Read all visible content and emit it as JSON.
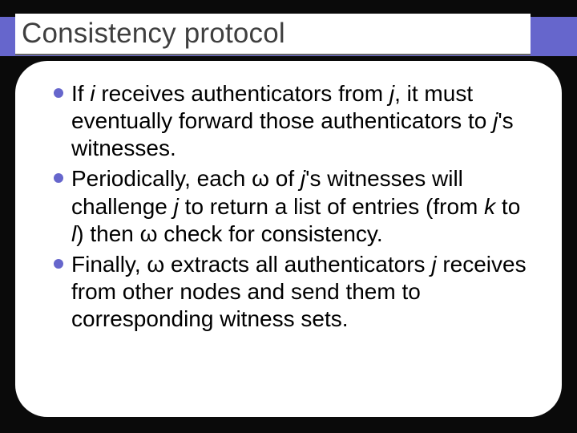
{
  "slide": {
    "title": "Consistency protocol",
    "bullets": [
      {
        "prefix": "If ",
        "i1": "i",
        "mid1": " receives authenticators from ",
        "j1": "j",
        "mid2": ", it must eventually forward  those authenticators to ",
        "j2": "j",
        "suffix": "'s witnesses."
      },
      {
        "prefix": "Periodically, each ω of ",
        "j1": "j",
        "mid1": "'s witnesses will challenge ",
        "j2": "j",
        "mid2": " to return a list of entries (from ",
        "k": "k",
        "mid3": " to ",
        "l": "l",
        "suffix": ") then ω check for consistency."
      },
      {
        "prefix": "Finally, ω extracts all authenticators ",
        "j1": "j",
        "suffix": " receives from other nodes and send them to corresponding witness sets."
      }
    ]
  }
}
